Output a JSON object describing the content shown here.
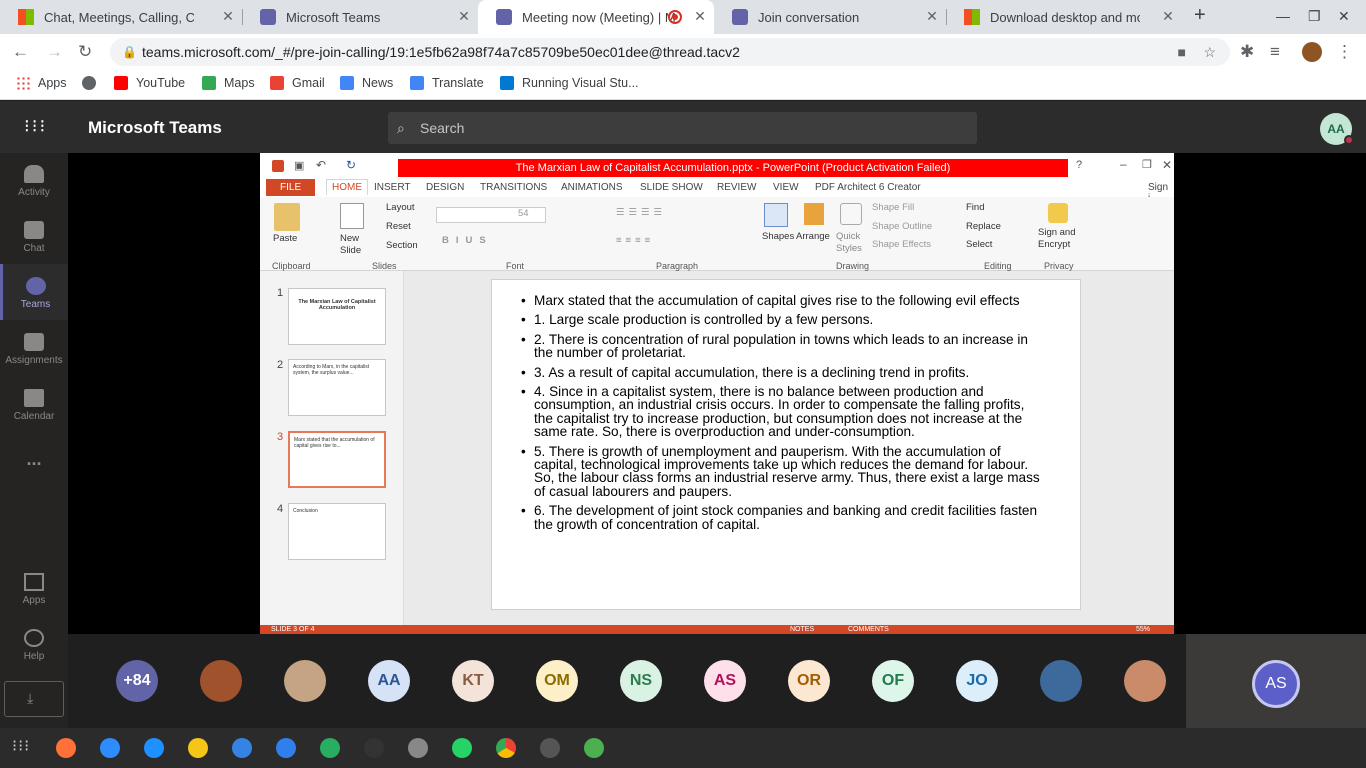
{
  "tabs": [
    {
      "title": "Chat, Meetings, Calling, Collabo",
      "color": "#f25022"
    },
    {
      "title": "Microsoft Teams",
      "color": "#6264a7"
    },
    {
      "title": "Meeting now (Meeting) | M",
      "color": "#6264a7"
    },
    {
      "title": "Join conversation",
      "color": "#6264a7"
    },
    {
      "title": "Download desktop and mobile",
      "color": "#f25022"
    }
  ],
  "url": "teams.microsoft.com/_#/pre-join-calling/19:1e5fb62a98f74a7c85709be50ec01dee@thread.tacv2",
  "bookmarks": [
    "Apps",
    "YouTube",
    "Maps",
    "Gmail",
    "News",
    "Translate",
    "Running Visual Stu..."
  ],
  "teams": {
    "title": "Microsoft Teams",
    "search_placeholder": "Search",
    "avatar": "AA"
  },
  "rail": [
    "Activity",
    "Chat",
    "Teams",
    "Assignments",
    "Calendar",
    "...",
    "Apps",
    "Help"
  ],
  "ppt": {
    "title": "The Marxian Law of Capitalist Accumulation.pptx -  PowerPoint (Product Activation Failed)",
    "menu": [
      "FILE",
      "HOME",
      "INSERT",
      "DESIGN",
      "TRANSITIONS",
      "ANIMATIONS",
      "SLIDE SHOW",
      "REVIEW",
      "VIEW",
      "PDF Architect 6 Creator",
      "Sign i"
    ],
    "groups": [
      "Clipboard",
      "Slides",
      "Font",
      "Paragraph",
      "Drawing",
      "Editing",
      "Privacy"
    ],
    "ribbon": {
      "paste": "Paste",
      "new_slide": "New Slide",
      "layout": "Layout",
      "reset": "Reset",
      "section": "Section",
      "font_size": "54",
      "shapes": "Shapes",
      "arrange": "Arrange",
      "quick_styles": "Quick Styles",
      "shape_fill": "Shape Fill",
      "shape_outline": "Shape Outline",
      "shape_effects": "Shape Effects",
      "find": "Find",
      "replace": "Replace",
      "select": "Select",
      "sign": "Sign and Encrypt"
    },
    "thumbs": [
      {
        "num": "1",
        "text": "The Marxian Law of Capitalist Accumulation"
      },
      {
        "num": "2",
        "text": "According to Marx, in the capitalist system, the surplus value..."
      },
      {
        "num": "3",
        "text": "Marx stated that the accumulation of capital gives rise to..."
      },
      {
        "num": "4",
        "text": "Conclusion"
      }
    ],
    "bullets": [
      "Marx stated that the accumulation of capital gives rise to the following evil effects",
      "1. Large scale production is controlled by a few persons.",
      "2. There is concentration of rural population in towns which leads to an increase in the number of proletariat.",
      "3. As a result of capital accumulation, there is a declining trend in profits.",
      "4. Since in a capitalist system, there is no balance between production and consumption, an industrial crisis occurs. In order to compensate the falling profits, the capitalist try to increase production, but consumption does not increase at the same rate. So, there is overproduction and under-consumption.",
      "5. There is growth of unemployment and pauperism. With the accumulation of capital, technological improvements take up which reduces the demand for labour. So, the labour class forms an industrial reserve army. Thus, there exist a large mass of casual labourers and paupers.",
      "6. The development of joint stock companies and banking and credit facilities fasten the growth of concentration of capital."
    ],
    "status": {
      "slide": "SLIDE 3 OF 4",
      "notes": "NOTES",
      "comments": "COMMENTS",
      "zoom": "55%"
    }
  },
  "participants": [
    {
      "label": "+84",
      "bg": "#6264a7",
      "fg": "#ffffff"
    },
    {
      "label": "",
      "bg": "#a0522d",
      "fg": "#fff"
    },
    {
      "label": "",
      "bg": "#c4a484",
      "fg": "#fff"
    },
    {
      "label": "AA",
      "bg": "#d6e2f5",
      "fg": "#2f5597"
    },
    {
      "label": "KT",
      "bg": "#f3e3d9",
      "fg": "#8a5a44"
    },
    {
      "label": "OM",
      "bg": "#fdf0c8",
      "fg": "#8a6d00"
    },
    {
      "label": "NS",
      "bg": "#d9f2e4",
      "fg": "#2e7d4f"
    },
    {
      "label": "AS",
      "bg": "#fde0ea",
      "fg": "#b0125a"
    },
    {
      "label": "OR",
      "bg": "#fbe7d2",
      "fg": "#a35c00"
    },
    {
      "label": "OF",
      "bg": "#def5e9",
      "fg": "#237b4b"
    },
    {
      "label": "JO",
      "bg": "#dceefa",
      "fg": "#1a6aa8"
    },
    {
      "label": "",
      "bg": "#3d6a9b",
      "fg": "#fff"
    },
    {
      "label": "",
      "bg": "#c98b6a",
      "fg": "#fff"
    }
  ],
  "self": {
    "label": "AS"
  }
}
